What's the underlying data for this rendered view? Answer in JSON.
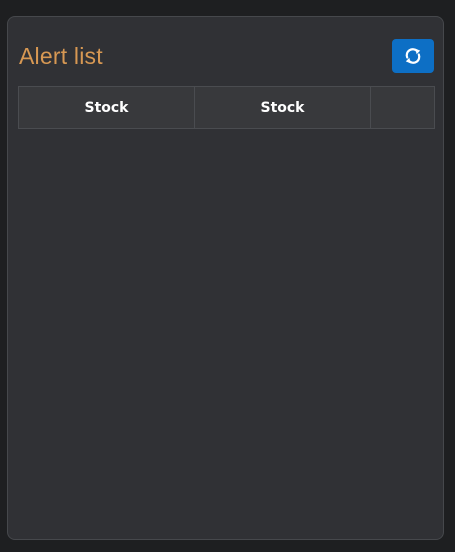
{
  "panel": {
    "title": "Alert list",
    "refresh_icon": "refresh-icon",
    "accent_color": "#d79853",
    "button_color": "#0d6fc5"
  },
  "table": {
    "columns": [
      "Stock",
      "Stock",
      ""
    ],
    "rows": []
  }
}
